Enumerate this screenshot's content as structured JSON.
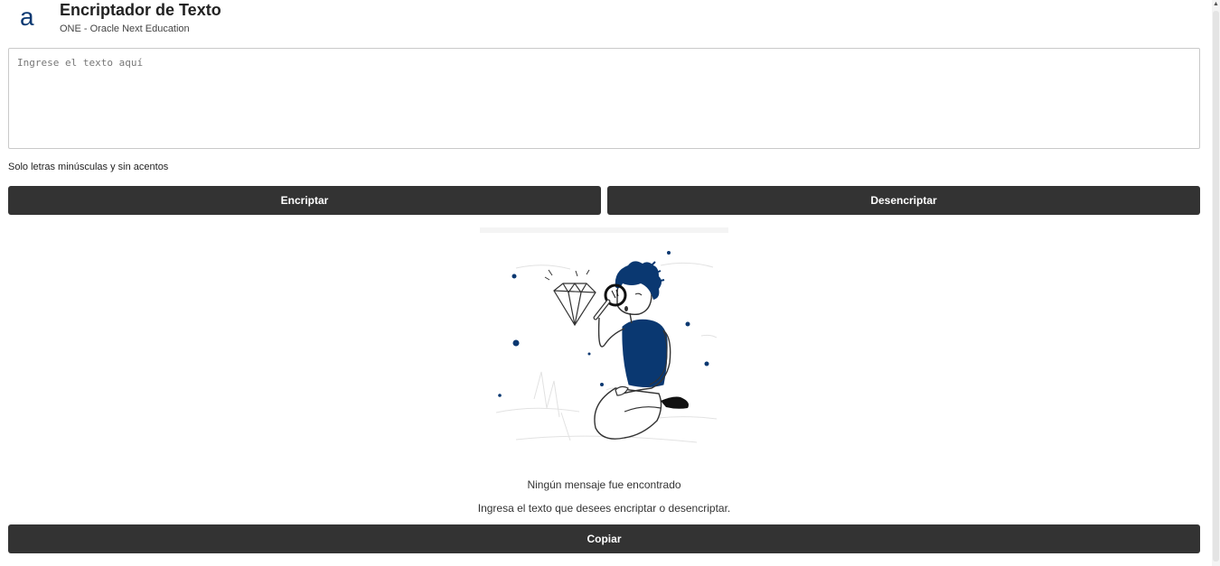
{
  "header": {
    "logo_text": "a",
    "title": "Encriptador de Texto",
    "subtitle": "ONE - Oracle Next Education"
  },
  "input": {
    "value": "",
    "placeholder": "Ingrese el texto aquí"
  },
  "hint": "Solo letras minúsculas y sin acentos",
  "buttons": {
    "encrypt": "Encriptar",
    "decrypt": "Desencriptar",
    "copy": "Copiar"
  },
  "result": {
    "title": "Ningún mensaje fue encontrado",
    "body": "Ingresa el texto que desees encriptar o desencriptar."
  },
  "icons": {
    "scroll_up": "up-arrow-icon"
  },
  "colors": {
    "button_bg": "#333333",
    "button_text": "#ffffff",
    "logo": "#0a3871",
    "illustration_accent": "#0a3871"
  }
}
